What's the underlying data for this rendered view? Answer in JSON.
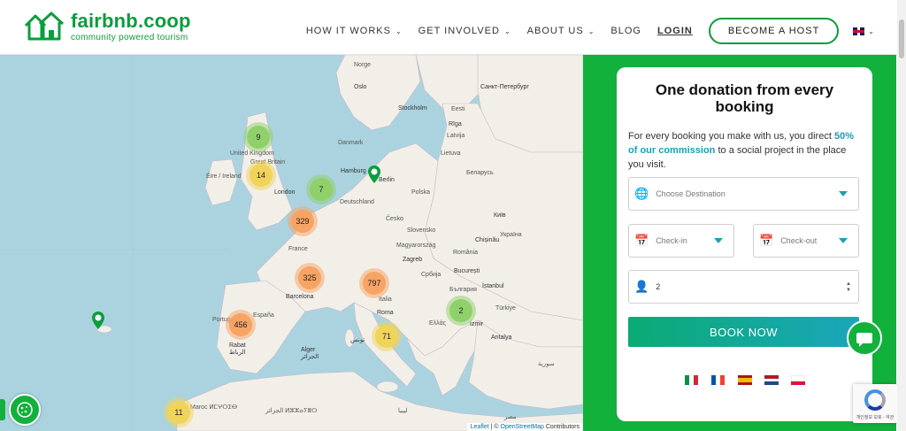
{
  "header": {
    "brand": "fairbnb.coop",
    "tagline": "community powered tourism",
    "nav": [
      {
        "label": "HOW IT WORKS",
        "dropdown": true
      },
      {
        "label": "GET INVOLVED",
        "dropdown": true
      },
      {
        "label": "ABOUT US",
        "dropdown": true
      },
      {
        "label": "BLOG",
        "dropdown": false
      }
    ],
    "login": "LOGIN",
    "become_host": "BECOME A HOST",
    "language_icon": "uk-flag-icon"
  },
  "map": {
    "labels": {
      "norway": "Norge",
      "oslo": "Oslo",
      "stockholm": "Stockholm",
      "spb": "Санкт-Петербург",
      "eesti": "Eesti",
      "riga": "Rīga",
      "latvija": "Latvija",
      "lietuva": "Lietuva",
      "danmark": "Danmark",
      "uk": "United Kingdom",
      "gb": "Great Britain",
      "eire": "Éire / Ireland",
      "london": "London",
      "hamburg": "Hamburg",
      "berlin": "Berlin",
      "deutschland": "Deutschland",
      "polska": "Polska",
      "belarus": "Беларусь",
      "cesko": "Česko",
      "kyiv": "Київ",
      "ukraina": "Україна",
      "slovensko": "Slovensko",
      "magyar": "Magyarország",
      "chisinau": "Chișinău",
      "romania": "România",
      "france": "France",
      "zagreb": "Zagreb",
      "bucuresti": "București",
      "srbija": "Србија",
      "bulgaria": "България",
      "italia": "Italia",
      "barcelona": "Barcelona",
      "roma": "Roma",
      "istanbul": "İstanbul",
      "portugal": "Portugal",
      "espana": "España",
      "ellas": "Ελλάς",
      "izmir": "İzmir",
      "turkiye": "Türkiye",
      "antalya": "Antalya",
      "tunis": "تونس",
      "rabat": "Rabat\nالرباط",
      "alger": "Alger\nالجزائر",
      "maroc": "Maroc ⵍⵎⵖⵔⵉⴱ",
      "algeria": "الجزائر ⵍⵣⵣⴰⵢⴻⵔ",
      "libya": "ليبيا",
      "syria": "سورية",
      "egypt": "مصر"
    },
    "clusters": [
      {
        "count": "9",
        "color": "green"
      },
      {
        "count": "14",
        "color": "yellow"
      },
      {
        "count": "7",
        "color": "green"
      },
      {
        "count": "329",
        "color": "orange"
      },
      {
        "count": "325",
        "color": "orange"
      },
      {
        "count": "797",
        "color": "orange"
      },
      {
        "count": "456",
        "color": "orange"
      },
      {
        "count": "2",
        "color": "green"
      },
      {
        "count": "71",
        "color": "yellow"
      },
      {
        "count": "11",
        "color": "yellow"
      }
    ],
    "attribution_leaflet": "Leaflet",
    "attribution_sep": " | © ",
    "attribution_osm": "OpenStreetMap",
    "attribution_contrib": " Contributors"
  },
  "booking": {
    "title": "One donation from every booking",
    "desc_before": "For every booking you make with us, you direct ",
    "desc_highlight": "50% of our commission",
    "desc_after": " to a social project in the place you visit.",
    "destination_placeholder": "Choose Destination",
    "checkin_placeholder": "Check-in",
    "checkout_placeholder": "Check-out",
    "guests": "2",
    "book_now": "BOOK NOW",
    "languages": [
      "it",
      "fr",
      "es",
      "nl",
      "pl"
    ]
  },
  "recaptcha": {
    "text": "개인정보 보호 - 약관"
  },
  "colors": {
    "brand_green": "#11b13c",
    "logo_green": "#0a9d3d",
    "accent_teal": "#1aa0b6"
  }
}
